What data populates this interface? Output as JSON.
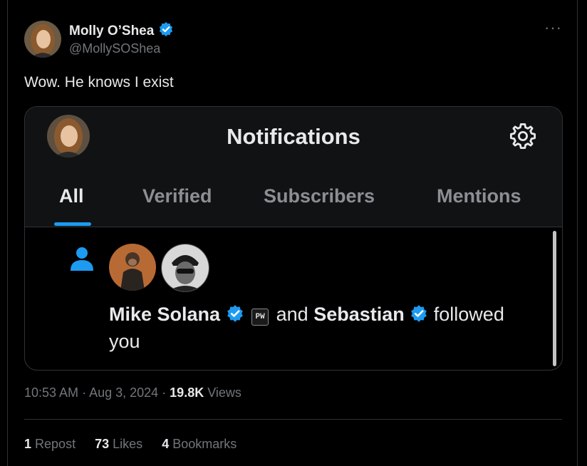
{
  "tweet": {
    "author_name": "Molly O’Shea",
    "handle": "@MollySOShea",
    "more_icon": "more-horizontal-icon",
    "text": "Wow. He knows I exist",
    "time": "10:53 AM",
    "date": "Aug 3, 2024",
    "views_count": "19.8K",
    "views_label": "Views",
    "stats": [
      {
        "count": "1",
        "label": "Repost"
      },
      {
        "count": "73",
        "label": "Likes"
      },
      {
        "count": "4",
        "label": "Bookmarks"
      }
    ],
    "colors": {
      "verified": "#1d9bf0",
      "background": "#000000",
      "muted": "#71767b"
    }
  },
  "screenshot": {
    "title": "Notifications",
    "settings_icon": "gear-icon",
    "tabs": [
      {
        "label": "All",
        "active": true
      },
      {
        "label": "Verified",
        "active": false
      },
      {
        "label": "Subscribers",
        "active": false
      },
      {
        "label": "Mentions",
        "active": false
      }
    ],
    "notification": {
      "icon": "person-icon",
      "user1": "Mike Solana",
      "badge": "PW",
      "connector": "and",
      "user2": "Sebastian",
      "action": "followed you"
    },
    "colors": {
      "accent": "#1d9bf0",
      "header_bg": "#111213"
    }
  }
}
